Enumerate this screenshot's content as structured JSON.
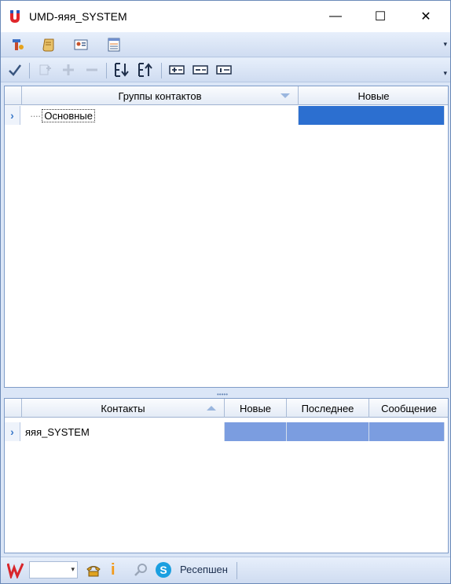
{
  "window": {
    "title": "UMD-яяя_SYSTEM"
  },
  "window_controls": {
    "minimize": "—",
    "maximize": "☐",
    "close": "✕"
  },
  "toolbar1": {
    "items": [
      "settings-tools",
      "scroll-document",
      "contact-card",
      "report-table"
    ],
    "overflow_glyph": "▾"
  },
  "toolbar2": {
    "items": [
      "check",
      "add-group",
      "add",
      "remove",
      "sort-descending",
      "sort-ascending",
      "expand-all",
      "collapse-all",
      "info"
    ],
    "overflow_glyph": "▾"
  },
  "groups_grid": {
    "columns": [
      "Группы контактов",
      "Новые"
    ],
    "rows": [
      {
        "name": "Основные",
        "new": ""
      }
    ]
  },
  "contacts_grid": {
    "columns": [
      "Контакты",
      "Новые",
      "Последнее",
      "Сообщение"
    ],
    "rows": [
      {
        "name": "яяя_SYSTEM",
        "new": "",
        "last": "",
        "message": ""
      }
    ]
  },
  "statusbar": {
    "combo_value": "",
    "label": "Ресепшен"
  },
  "colors": {
    "selected_cell": "#2c6fd0",
    "secondary_cell": "#7b9de0",
    "chrome": "#dbe6f7"
  }
}
